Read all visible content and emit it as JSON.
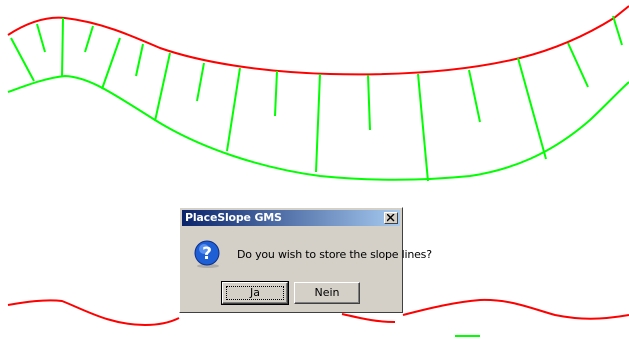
{
  "dialog": {
    "title": "PlaceSlope GMS",
    "message": "Do you wish to store the slope lines?",
    "yes_label": "Ja",
    "no_label": "Nein",
    "icon": "question-icon"
  },
  "colors": {
    "top_edge": "#ff0000",
    "toe_edge": "#00ff00",
    "slope_lines": "#00dd00"
  }
}
